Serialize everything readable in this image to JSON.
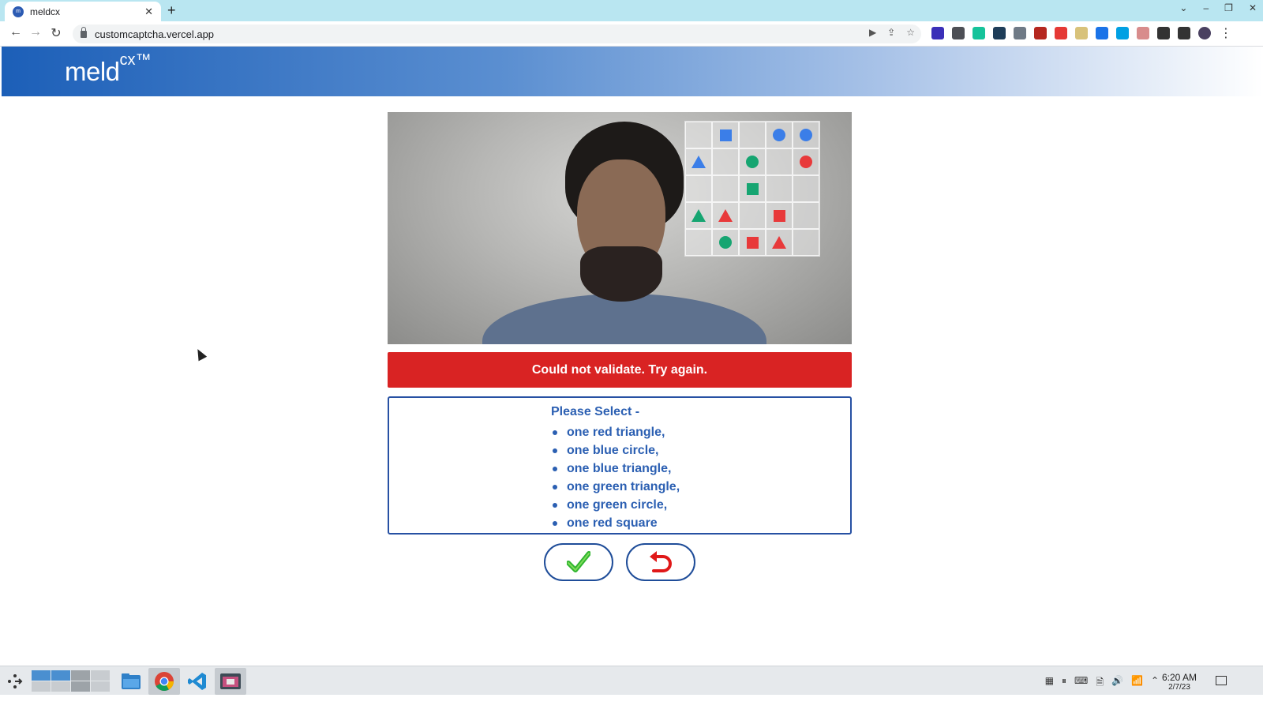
{
  "browser": {
    "tab_title": "meldcx",
    "tab_close": "✕",
    "new_tab": "+",
    "url": "customcaptcha.vercel.app",
    "window_controls": [
      "⌄",
      "–",
      "❐",
      "✕"
    ],
    "nav": {
      "back": "←",
      "forward": "→",
      "reload": "↻"
    },
    "omnibox_icons": [
      "▶",
      "⇪",
      "☆"
    ],
    "extensions": [
      {
        "name": "extension-1-icon",
        "color": "#3b2fb8"
      },
      {
        "name": "extension-2-icon",
        "color": "#4d4f55"
      },
      {
        "name": "grammarly-icon",
        "color": "#15c39a"
      },
      {
        "name": "extension-4-icon",
        "color": "#1e3d59"
      },
      {
        "name": "extension-5-icon",
        "color": "#6f7a86"
      },
      {
        "name": "ublock-icon",
        "color": "#b5271f"
      },
      {
        "name": "record-icon",
        "color": "#e53935"
      },
      {
        "name": "notes-icon",
        "color": "#d8c27a"
      },
      {
        "name": "screenshot-icon",
        "color": "#1a73e8"
      },
      {
        "name": "extension-10-icon",
        "color": "#00a0e3"
      },
      {
        "name": "extension-11-icon",
        "color": "#d88c8c"
      },
      {
        "name": "puzzle-icon",
        "color": "#333333"
      },
      {
        "name": "sidepanel-icon",
        "color": "#333333"
      },
      {
        "name": "profile-avatar-icon",
        "color": "#4a4060"
      }
    ],
    "menu": "⋮"
  },
  "page": {
    "logo": {
      "main": "meld",
      "sup": "cx™"
    },
    "grid": [
      [
        null,
        {
          "shape": "square",
          "color": "#3b7ee8"
        },
        null,
        {
          "shape": "circle",
          "color": "#3b7ee8"
        },
        {
          "shape": "circle",
          "color": "#3b7ee8"
        }
      ],
      [
        {
          "shape": "triangle",
          "color": "#3b7ee8"
        },
        null,
        {
          "shape": "circle",
          "color": "#16a571"
        },
        null,
        {
          "shape": "circle",
          "color": "#e8393a"
        }
      ],
      [
        null,
        null,
        {
          "shape": "square",
          "color": "#16a571"
        },
        null,
        null
      ],
      [
        {
          "shape": "triangle",
          "color": "#16a571"
        },
        {
          "shape": "triangle",
          "color": "#e8393a"
        },
        null,
        {
          "shape": "square",
          "color": "#e8393a"
        },
        null
      ],
      [
        null,
        {
          "shape": "circle",
          "color": "#16a571"
        },
        {
          "shape": "square",
          "color": "#e8393a"
        },
        {
          "shape": "triangle",
          "color": "#e8393a"
        },
        null
      ]
    ],
    "error_message": "Could not validate. Try again.",
    "instructions": {
      "heading": "Please Select -",
      "items": [
        "one red triangle,",
        "one blue circle,",
        "one blue triangle,",
        "one green triangle,",
        "one green circle,",
        "one red square"
      ]
    },
    "colors": {
      "error": "#d92323",
      "accent": "#2b5fb2",
      "confirm": "#2fb52f",
      "retry": "#e01818"
    }
  },
  "taskbar": {
    "tray_icons": [
      "▦",
      "⏸",
      "⌨",
      "🗎",
      "🔊",
      "📶",
      "⌃"
    ],
    "time": "6:20 AM",
    "date": "2/7/23"
  }
}
